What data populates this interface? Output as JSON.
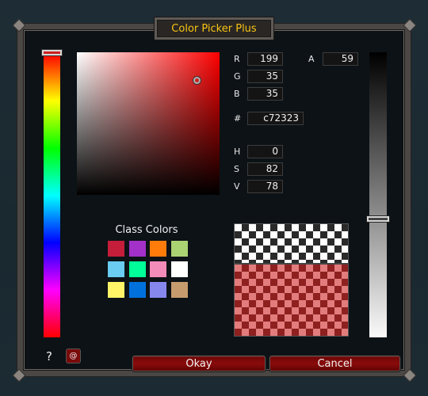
{
  "window": {
    "title": "Color Picker Plus"
  },
  "color": {
    "r": {
      "label": "R",
      "value": "199"
    },
    "g": {
      "label": "G",
      "value": "35"
    },
    "b": {
      "label": "B",
      "value": "35"
    },
    "a": {
      "label": "A",
      "value": "59"
    },
    "hex": {
      "label": "#",
      "value": "c72323"
    },
    "h": {
      "label": "H",
      "value": "0"
    },
    "s": {
      "label": "S",
      "value": "82"
    },
    "v": {
      "label": "V",
      "value": "78"
    }
  },
  "class_colors": {
    "title": "Class Colors",
    "swatches": [
      "#c41e3a",
      "#a330c9",
      "#ff7c0a",
      "#aad372",
      "#69ccf0",
      "#00ff98",
      "#f48cba",
      "#ffffff",
      "#fff468",
      "#0070dd",
      "#8788ee",
      "#c69b6d"
    ]
  },
  "footer": {
    "help": "?",
    "at": "@",
    "okay": "Okay",
    "cancel": "Cancel"
  }
}
